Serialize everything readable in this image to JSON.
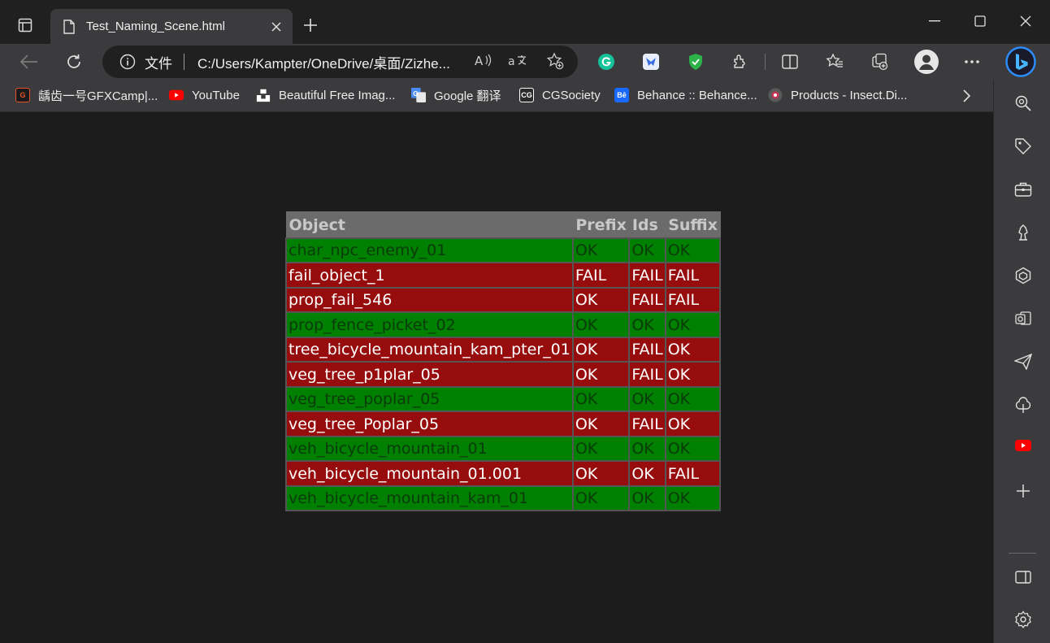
{
  "tab": {
    "title": "Test_Naming_Scene.html"
  },
  "address_bar": {
    "scheme_label": "文件",
    "url": "C:/Users/Kampter/OneDrive/桌面/Zizhe..."
  },
  "favorites": [
    {
      "label": "龋齿一号GFXCamp|...",
      "icon": "gfxcamp-icon",
      "color": "#e8532a"
    },
    {
      "label": "YouTube",
      "icon": "youtube-icon",
      "color": "#ff0000"
    },
    {
      "label": "Beautiful Free Imag...",
      "icon": "unsplash-icon",
      "color": "#ffffff"
    },
    {
      "label": "Google 翻译",
      "icon": "google-translate-icon",
      "color": "#4a8af4"
    },
    {
      "label": "CGSociety",
      "icon": "cgsociety-icon",
      "color": "#444444"
    },
    {
      "label": "Behance :: Behance...",
      "icon": "behance-icon",
      "color": "#1769ff"
    },
    {
      "label": "Products - Insect.Di...",
      "icon": "insect-icon",
      "color": "#cc3355"
    }
  ],
  "table": {
    "headers": [
      "Object",
      "Prefix",
      "Ids",
      "Suffix"
    ],
    "rows": [
      {
        "status": "pass",
        "cells": [
          "char_npc_enemy_01",
          "OK",
          "OK",
          "OK"
        ]
      },
      {
        "status": "fail",
        "cells": [
          "fail_object_1",
          "FAIL",
          "FAIL",
          "FAIL"
        ]
      },
      {
        "status": "fail",
        "cells": [
          "prop_fail_546",
          "OK",
          "FAIL",
          "FAIL"
        ]
      },
      {
        "status": "pass",
        "cells": [
          "prop_fence_picket_02",
          "OK",
          "OK",
          "OK"
        ]
      },
      {
        "status": "fail",
        "cells": [
          "tree_bicycle_mountain_kam_pter_01",
          "OK",
          "FAIL",
          "OK"
        ]
      },
      {
        "status": "fail",
        "cells": [
          "veg_tree_p1plar_05",
          "OK",
          "FAIL",
          "OK"
        ]
      },
      {
        "status": "pass",
        "cells": [
          "veg_tree_poplar_05",
          "OK",
          "OK",
          "OK"
        ]
      },
      {
        "status": "fail",
        "cells": [
          "veg_tree_Poplar_05",
          "OK",
          "FAIL",
          "OK"
        ]
      },
      {
        "status": "pass",
        "cells": [
          "veh_bicycle_mountain_01",
          "OK",
          "OK",
          "OK"
        ]
      },
      {
        "status": "fail",
        "cells": [
          "veh_bicycle_mountain_01.001",
          "OK",
          "OK",
          "FAIL"
        ]
      },
      {
        "status": "pass",
        "cells": [
          "veh_bicycle_mountain_kam_01",
          "OK",
          "OK",
          "OK"
        ]
      }
    ]
  },
  "colors": {
    "pass_row": "#008000",
    "fail_row": "#970d0d",
    "header_row": "#6b6b6b"
  }
}
